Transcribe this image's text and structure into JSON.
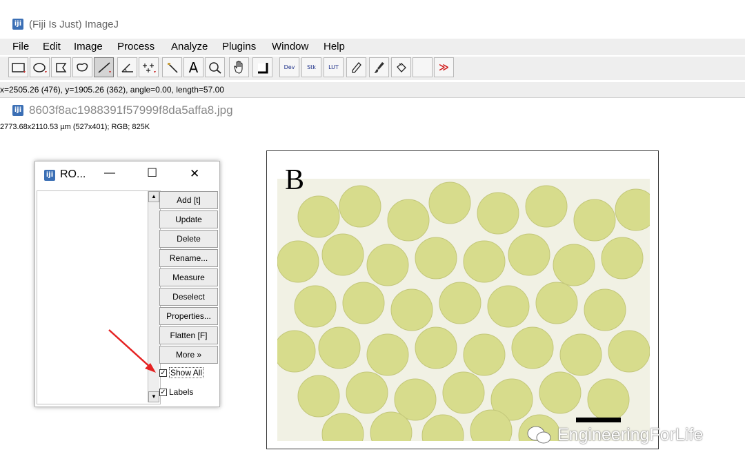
{
  "app": {
    "title": "(Fiji Is Just) ImageJ",
    "icon": "fiji-icon"
  },
  "menu": [
    "File",
    "Edit",
    "Image",
    "Process",
    "Analyze",
    "Plugins",
    "Window",
    "Help"
  ],
  "toolbar": {
    "tools": [
      {
        "name": "rectangle-tool"
      },
      {
        "name": "oval-tool"
      },
      {
        "name": "polygon-tool"
      },
      {
        "name": "freehand-tool"
      },
      {
        "name": "straight-line-tool",
        "selected": true
      },
      {
        "name": "angle-tool"
      },
      {
        "name": "point-tool"
      },
      {
        "name": "wand-tool"
      },
      {
        "name": "text-tool",
        "label": "A"
      },
      {
        "name": "magnifying-glass-tool"
      },
      {
        "name": "scrolling-tool"
      },
      {
        "name": "color-picker-tool"
      },
      {
        "name": "developer-menu",
        "label": "Dev"
      },
      {
        "name": "stacks-menu",
        "label": "Stk"
      },
      {
        "name": "lut-menu",
        "label": "LUT"
      },
      {
        "name": "pencil-tool"
      },
      {
        "name": "brush-tool"
      },
      {
        "name": "flood-filler-tool"
      },
      {
        "name": "empty-slot"
      },
      {
        "name": "more-tools-switch",
        "label": "≫"
      }
    ]
  },
  "status": "x=2505.26 (476), y=1905.26 (362), angle=0.00, length=57.00",
  "image_window": {
    "title": "8603f8ac1988391f57999f8da5affa8.jpg",
    "info": "2773.68x2110.53 µm (527x401); RGB; 825K"
  },
  "roi_manager": {
    "title": "RO...",
    "window_controls": {
      "minimize": "—",
      "maximize": "☐",
      "close": "✕"
    },
    "buttons": [
      "Add [t]",
      "Update",
      "Delete",
      "Rename...",
      "Measure",
      "Deselect",
      "Properties...",
      "Flatten [F]",
      "More »"
    ],
    "show_all": {
      "label": "Show All",
      "checked": true
    },
    "labels": {
      "label": "Labels",
      "checked": true
    }
  },
  "figure": {
    "label": "B"
  },
  "watermark": "EngineeringForLife",
  "colors": {
    "annotation_arrow": "#e52222",
    "menubar_bg": "#eeeeee",
    "fiji_blue": "#3b6fb5",
    "bead": "#d7dc8c"
  }
}
